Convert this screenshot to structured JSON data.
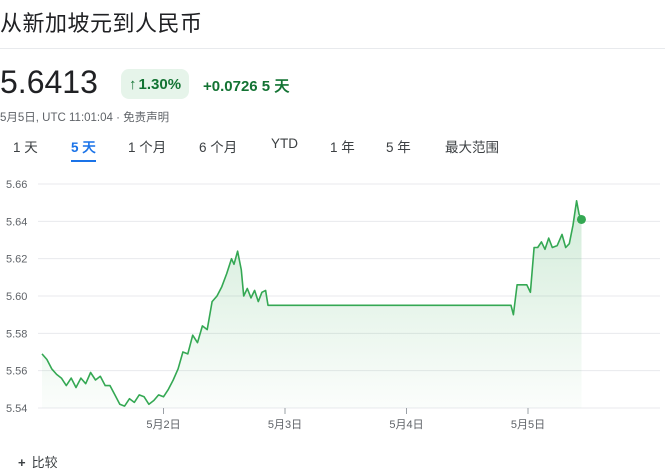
{
  "title": "从新加坡元到人民币",
  "price": "5.6413",
  "percent_change": "1.30%",
  "percent_arrow": "↑",
  "abs_change": "+0.0726 5 天",
  "meta": "5月5日, UTC 11:01:04 · 免责声明",
  "tabs": [
    {
      "label": "1 天",
      "active": false
    },
    {
      "label": "5 天",
      "active": true
    },
    {
      "label": "1 个月",
      "active": false
    },
    {
      "label": "6 个月",
      "active": false
    },
    {
      "label": "YTD",
      "active": false
    },
    {
      "label": "1 年",
      "active": false
    },
    {
      "label": "5 年",
      "active": false
    },
    {
      "label": "最大范围",
      "active": false
    }
  ],
  "bottom_label": "比较",
  "colors": {
    "line": "#34a853",
    "positive": "#137333",
    "badge_bg": "#e6f4ea",
    "active_tab": "#1a73e8",
    "grid": "#e8eaed"
  },
  "chart_data": {
    "type": "line",
    "title": "",
    "xlabel": "",
    "ylabel": "",
    "ylim": [
      5.54,
      5.66
    ],
    "yticks": [
      5.54,
      5.56,
      5.58,
      5.6,
      5.62,
      5.64,
      5.66
    ],
    "xticks": [
      {
        "label": "5月2日",
        "x": 1
      },
      {
        "label": "5月3日",
        "x": 2
      },
      {
        "label": "5月4日",
        "x": 3
      },
      {
        "label": "5月5日",
        "x": 4
      }
    ],
    "xlim": [
      0,
      5
    ],
    "grid": true,
    "series": [
      {
        "values": [
          [
            0.0,
            5.569
          ],
          [
            0.04,
            5.566
          ],
          [
            0.08,
            5.561
          ],
          [
            0.12,
            5.558
          ],
          [
            0.16,
            5.556
          ],
          [
            0.2,
            5.552
          ],
          [
            0.24,
            5.556
          ],
          [
            0.28,
            5.551
          ],
          [
            0.32,
            5.556
          ],
          [
            0.36,
            5.553
          ],
          [
            0.4,
            5.559
          ],
          [
            0.44,
            5.555
          ],
          [
            0.48,
            5.557
          ],
          [
            0.52,
            5.552
          ],
          [
            0.56,
            5.552
          ],
          [
            0.6,
            5.547
          ],
          [
            0.64,
            5.542
          ],
          [
            0.68,
            5.541
          ],
          [
            0.72,
            5.545
          ],
          [
            0.76,
            5.543
          ],
          [
            0.8,
            5.547
          ],
          [
            0.84,
            5.546
          ],
          [
            0.88,
            5.542
          ],
          [
            0.92,
            5.544
          ],
          [
            0.96,
            5.547
          ],
          [
            1.0,
            5.546
          ],
          [
            1.04,
            5.55
          ],
          [
            1.08,
            5.555
          ],
          [
            1.12,
            5.561
          ],
          [
            1.16,
            5.57
          ],
          [
            1.2,
            5.569
          ],
          [
            1.24,
            5.579
          ],
          [
            1.28,
            5.575
          ],
          [
            1.32,
            5.584
          ],
          [
            1.36,
            5.582
          ],
          [
            1.4,
            5.597
          ],
          [
            1.44,
            5.6
          ],
          [
            1.48,
            5.605
          ],
          [
            1.52,
            5.612
          ],
          [
            1.56,
            5.62
          ],
          [
            1.58,
            5.617
          ],
          [
            1.61,
            5.624
          ],
          [
            1.64,
            5.614
          ],
          [
            1.66,
            5.6
          ],
          [
            1.69,
            5.604
          ],
          [
            1.72,
            5.599
          ],
          [
            1.75,
            5.603
          ],
          [
            1.78,
            5.597
          ],
          [
            1.81,
            5.602
          ],
          [
            1.84,
            5.603
          ],
          [
            1.86,
            5.595
          ],
          [
            2.0,
            5.595
          ],
          [
            2.5,
            5.595
          ],
          [
            3.0,
            5.595
          ],
          [
            3.5,
            5.595
          ],
          [
            3.86,
            5.595
          ],
          [
            3.88,
            5.59
          ],
          [
            3.91,
            5.606
          ],
          [
            3.95,
            5.606
          ],
          [
            3.99,
            5.606
          ],
          [
            4.02,
            5.602
          ],
          [
            4.05,
            5.626
          ],
          [
            4.08,
            5.626
          ],
          [
            4.11,
            5.629
          ],
          [
            4.14,
            5.625
          ],
          [
            4.17,
            5.631
          ],
          [
            4.2,
            5.626
          ],
          [
            4.24,
            5.627
          ],
          [
            4.28,
            5.633
          ],
          [
            4.31,
            5.626
          ],
          [
            4.34,
            5.628
          ],
          [
            4.37,
            5.638
          ],
          [
            4.4,
            5.651
          ],
          [
            4.42,
            5.644
          ],
          [
            4.44,
            5.641
          ]
        ]
      }
    ]
  }
}
